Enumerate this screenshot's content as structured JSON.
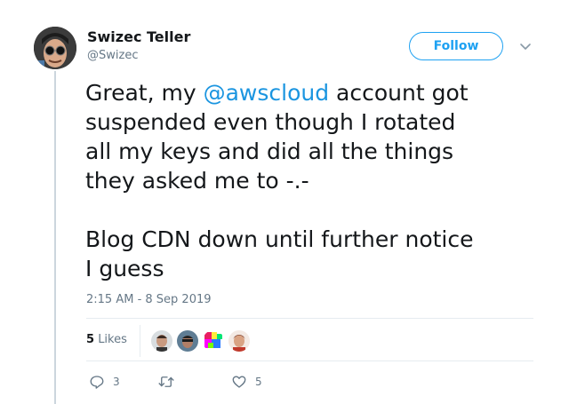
{
  "tweet": {
    "author": {
      "name": "Swizec Teller",
      "handle": "@Swizec"
    },
    "follow_label": "Follow",
    "text_lines": [
      {
        "pre": "Great, my ",
        "mention": "@awscloud",
        "post": " account got"
      },
      {
        "text": "suspended even though I rotated"
      },
      {
        "text": "all my keys and did all the things"
      },
      {
        "text": "they asked me to -.-"
      },
      {
        "text": "Blog CDN down until further notice"
      },
      {
        "text": "I guess"
      }
    ],
    "timestamp": "2:15 AM - 8 Sep 2019",
    "likes": {
      "count": "5",
      "label": "Likes"
    },
    "actions": {
      "replies": "3",
      "retweets": "",
      "likes": "5"
    },
    "colors": {
      "accent": "#1da1f2",
      "mention": "#1b95e0",
      "muted": "#657786"
    }
  }
}
